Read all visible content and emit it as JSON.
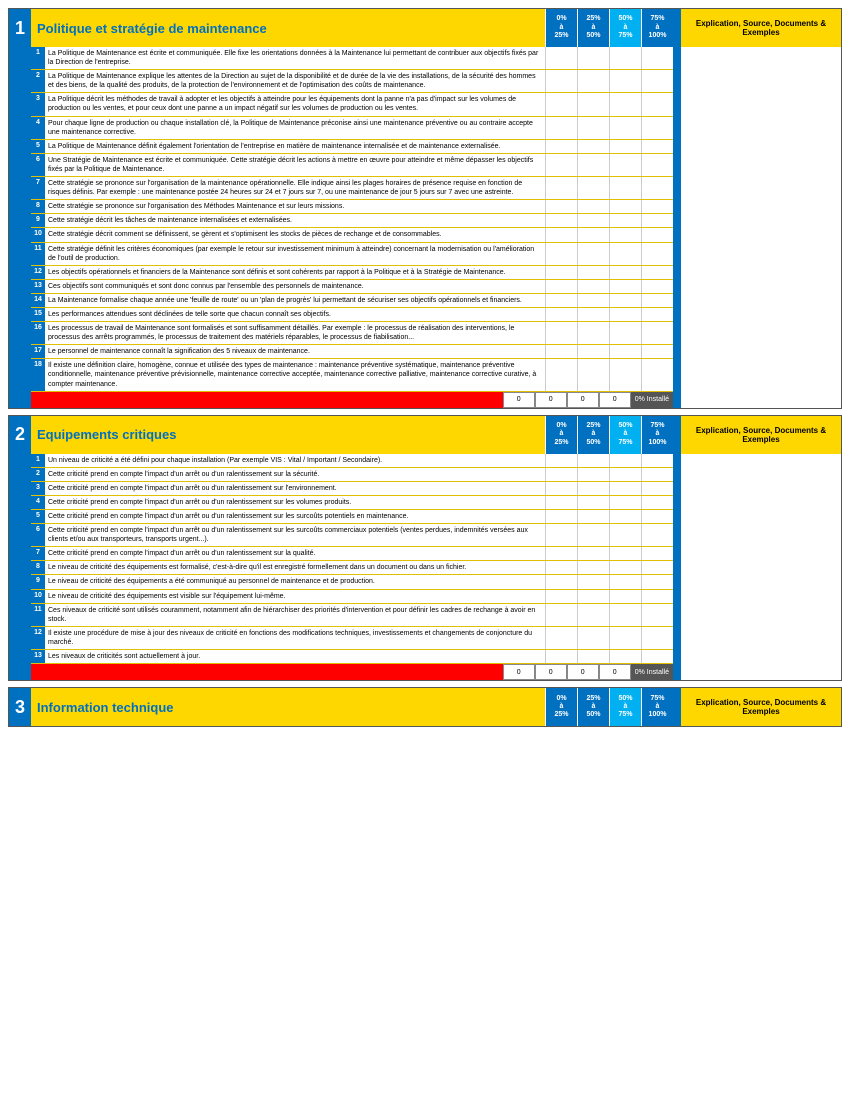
{
  "sections": [
    {
      "id": 1,
      "number": "1",
      "title": "Politique et stratégie de maintenance",
      "score_cols": [
        {
          "label": "0%\nà\n25%",
          "active": false
        },
        {
          "label": "25%\nà\n50%",
          "active": false
        },
        {
          "label": "50%\nà\n75%",
          "active": true
        },
        {
          "label": "75%\nà\n100%",
          "active": false
        }
      ],
      "explication_header": "Explication, Source,\nDocuments & Exemples",
      "items": [
        {
          "n": "1",
          "text": "La Politique de Maintenance est écrite et communiquée. Elle fixe les orientations données à la Maintenance lui permettant de contribuer aux objectifs fixés par la Direction de l'entreprise."
        },
        {
          "n": "2",
          "text": "La Politique de Maintenance explique les attentes de la Direction au sujet de la disponibilité et de durée de la vie des installations, de la sécurité des hommes et des biens, de la qualité des produits, de la protection de l'environnement et de l'optimisation des coûts de maintenance."
        },
        {
          "n": "3",
          "text": "La Politique décrit les méthodes de travail à adopter et les objectifs à atteindre pour les équipements dont la panne n'a pas d'impact sur les volumes de production ou les ventes, et pour ceux dont une panne a un impact négatif sur les volumes de production ou les ventes."
        },
        {
          "n": "4",
          "text": "Pour chaque ligne de production ou chaque installation clé, la Politique de Maintenance préconise ainsi une maintenance préventive ou au contraire accepte une maintenance corrective."
        },
        {
          "n": "5",
          "text": "La Politique de Maintenance définit également l'orientation de l'entreprise en matière de maintenance internalisée et de maintenance externalisée."
        },
        {
          "n": "6",
          "text": "Une Stratégie de Maintenance est écrite et communiquée. Cette stratégie décrit les actions à mettre en œuvre pour atteindre et même dépasser les objectifs fixés par la Politique de Maintenance."
        },
        {
          "n": "7",
          "text": "Cette stratégie se prononce sur l'organisation de la maintenance opérationnelle. Elle indique ainsi les plages horaires de présence requise en fonction de risques définis. Par exemple : une maintenance postée 24 heures sur 24 et 7 jours sur 7, ou une maintenance de jour 5 jours sur 7 avec une astreinte."
        },
        {
          "n": "8",
          "text": "Cette stratégie se prononce sur l'organisation des Méthodes Maintenance et sur leurs missions."
        },
        {
          "n": "9",
          "text": "Cette stratégie décrit les tâches de maintenance internalisées et externalisées."
        },
        {
          "n": "10",
          "text": "Cette stratégie décrit comment se définissent, se gèrent et s'optimisent les stocks de pièces de rechange et de consommables."
        },
        {
          "n": "11",
          "text": "Cette stratégie définit les critères économiques (par exemple le retour sur investissement minimum à atteindre) concernant la modernisation ou l'amélioration de l'outil de production."
        },
        {
          "n": "12",
          "text": "Les objectifs opérationnels et financiers de la Maintenance sont définis et sont cohérents par rapport à la Politique et à la Stratégie de Maintenance."
        },
        {
          "n": "13",
          "text": "Ces objectifs sont communiqués et sont donc connus par l'ensemble des personnels de maintenance."
        },
        {
          "n": "14",
          "text": "La Maintenance formalise chaque année une 'feuille de route' ou un 'plan de progrès' lui permettant de sécuriser ses objectifs opérationnels et financiers."
        },
        {
          "n": "15",
          "text": "Les performances attendues sont déclinées de telle sorte que chacun connaît ses objectifs."
        },
        {
          "n": "16",
          "text": "Les processus de travail de Maintenance sont formalisés et sont suffisamment détaillés. Par exemple : le processus de réalisation des interventions, le processus des arrêts programmés, le processus de traitement des matériels réparables, le processus de fiabilisation..."
        },
        {
          "n": "17",
          "text": "Le personnel de maintenance connaît la signification des 5 niveaux de maintenance."
        },
        {
          "n": "18",
          "text": "Il existe une définition claire, homogène, connue et utilisée des types de maintenance : maintenance préventive systématique, maintenance préventive conditionnelle, maintenance préventive prévisionnelle, maintenance corrective acceptée, maintenance corrective palliative, maintenance corrective curative, à compter maintenance."
        }
      ],
      "footer_scores": [
        "0",
        "0",
        "0",
        "0"
      ],
      "footer_pct": "0% Installé"
    },
    {
      "id": 2,
      "number": "2",
      "title": "Equipements critiques",
      "score_cols": [
        {
          "label": "0%\nà\n25%",
          "active": false
        },
        {
          "label": "25%\nà\n50%",
          "active": false
        },
        {
          "label": "50%\nà\n75%",
          "active": true
        },
        {
          "label": "75%\nà\n100%",
          "active": false
        }
      ],
      "explication_header": "Explication, Source,\nDocuments & Exemples",
      "items": [
        {
          "n": "1",
          "text": "Un niveau de criticité a été défini pour chaque installation (Par exemple VIS : Vital / Important / Secondaire)."
        },
        {
          "n": "2",
          "text": "Cette criticité prend en compte l'impact d'un arrêt ou d'un ralentissement sur la sécurité."
        },
        {
          "n": "3",
          "text": "Cette criticité prend en compte l'impact d'un arrêt ou d'un ralentissement sur l'environnement."
        },
        {
          "n": "4",
          "text": "Cette criticité prend en compte l'impact d'un arrêt ou d'un ralentissement sur les volumes produits."
        },
        {
          "n": "5",
          "text": "Cette criticité prend en compte l'impact d'un arrêt ou d'un ralentissement sur les surcoûts potentiels en maintenance."
        },
        {
          "n": "6",
          "text": "Cette criticité prend en compte l'impact d'un arrêt ou d'un ralentissement sur les surcoûts commerciaux potentiels (ventes perdues, indemnités versées aux clients et/ou aux transporteurs, transports urgent...)."
        },
        {
          "n": "7",
          "text": "Cette criticité prend en compte l'impact d'un arrêt ou d'un ralentissement sur la qualité."
        },
        {
          "n": "8",
          "text": "Le niveau de criticité des équipements est formalisé, c'est-à-dire qu'il est enregistré formellement dans un document ou dans un fichier."
        },
        {
          "n": "9",
          "text": "Le niveau de criticité des équipements a été communiqué au personnel de maintenance et de production."
        },
        {
          "n": "10",
          "text": "Le niveau de criticité des équipements est visible sur l'équipement lui-même."
        },
        {
          "n": "11",
          "text": "Ces niveaux de criticité sont utilisés couramment, notamment afin de hiérarchiser des priorités d'intervention et pour définir les cadres de rechange à avoir en stock."
        },
        {
          "n": "12",
          "text": "Il existe une procédure de mise à jour des niveaux de criticité en fonctions des modifications techniques, investissements et changements de conjoncture du marché."
        },
        {
          "n": "13",
          "text": "Les niveaux de criticités sont actuellement à jour."
        }
      ],
      "footer_scores": [
        "0",
        "0",
        "0",
        "0"
      ],
      "footer_pct": "0% Installé"
    },
    {
      "id": 3,
      "number": "3",
      "title": "Information technique",
      "score_cols": [
        {
          "label": "0%\nà\n25%",
          "active": false
        },
        {
          "label": "25%\nà\n50%",
          "active": false
        },
        {
          "label": "50%\nà\n75%",
          "active": true
        },
        {
          "label": "75%\nà\n100%",
          "active": false
        }
      ],
      "explication_header": "Explication, Source,\nDocuments & Exemples"
    }
  ]
}
